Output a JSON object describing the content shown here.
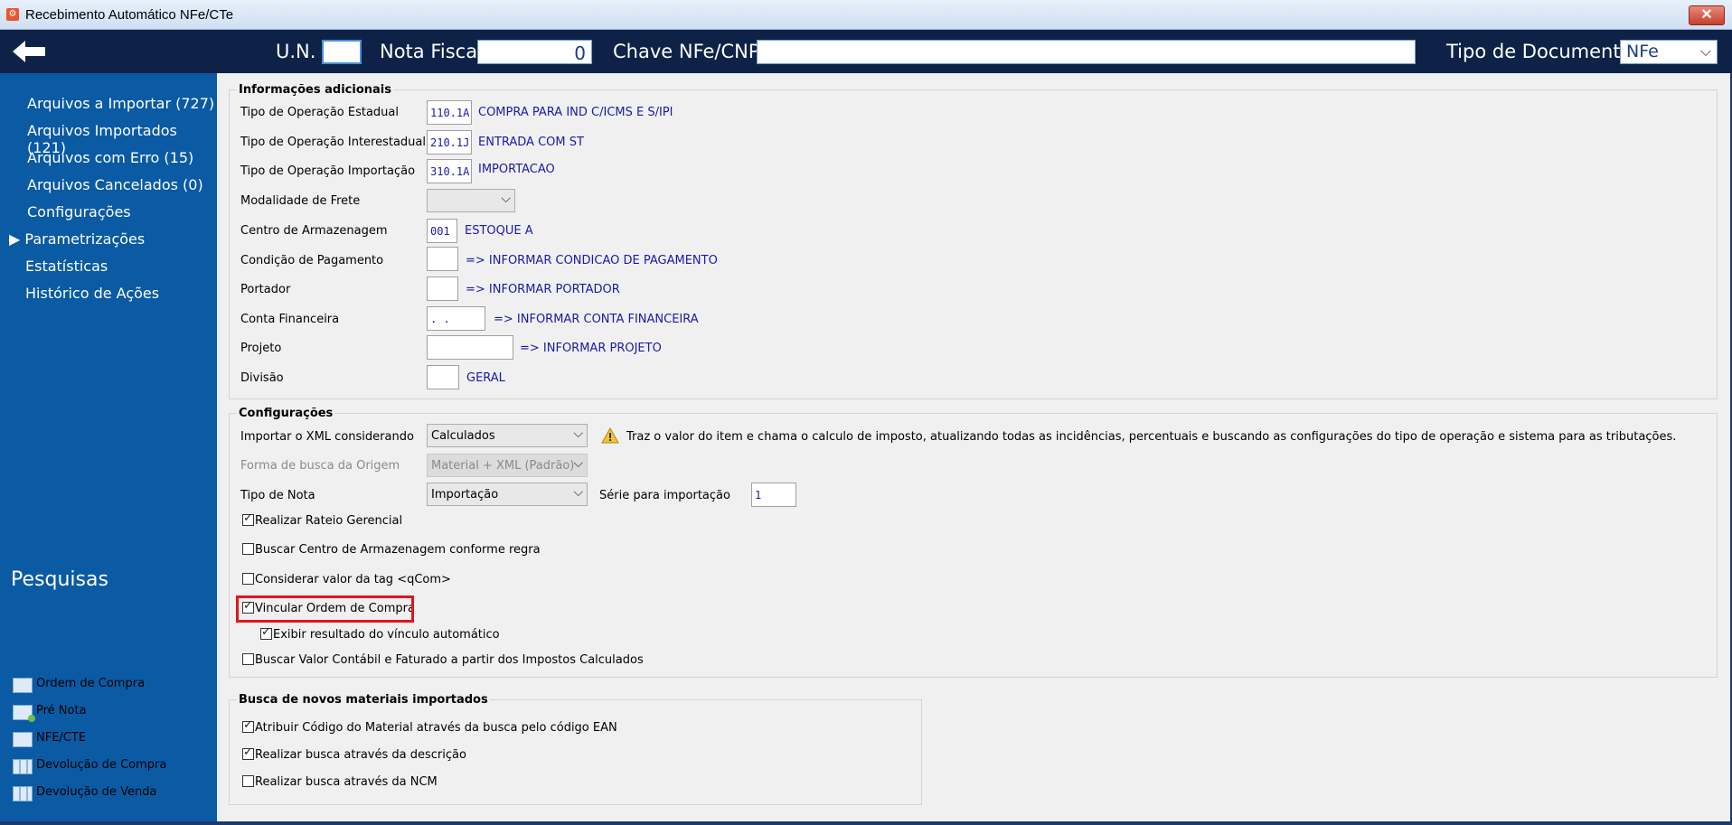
{
  "window": {
    "title": "Recebimento Automático NFe/CTe",
    "close_label": "✕"
  },
  "toolbar": {
    "un_label": "U.N.",
    "un_value": "",
    "nota_label": "Nota Fiscal",
    "nota_value": "0",
    "chave_label": "Chave NFe/CNPJ",
    "chave_value": "",
    "tipo_label": "Tipo de Documento",
    "tipo_value": "NFe",
    "chevron": "⌵"
  },
  "sidebar": {
    "items": [
      {
        "label": "Arquivos a Importar (727)"
      },
      {
        "label": "Arquivos Importados (121)"
      },
      {
        "label": "Arquivos com Erro (15)"
      },
      {
        "label": "Arquivos Cancelados (0)"
      },
      {
        "label": "Configurações"
      },
      {
        "label": "▶ Parametrizações"
      },
      {
        "label": "Estatísticas"
      },
      {
        "label": "Histórico de Ações"
      }
    ],
    "pesquisas_heading": "Pesquisas",
    "pesquisas": [
      {
        "label": "Ordem de Compra",
        "icon": "window-icon"
      },
      {
        "label": "Pré Nota",
        "icon": "window-add-icon"
      },
      {
        "label": "NFE/CTE",
        "icon": "windows-icon"
      },
      {
        "label": "Devolução de Compra",
        "icon": "grid-icon"
      },
      {
        "label": "Devolução de Venda",
        "icon": "grid-icon"
      }
    ]
  },
  "info": {
    "legend": "Informações adicionais",
    "rows": [
      {
        "label": "Tipo de Operação Estadual",
        "code": "110.1A",
        "desc": "COMPRA PARA IND C/ICMS E S/IPI"
      },
      {
        "label": "Tipo de Operação Interestadual",
        "code": "210.1J",
        "desc": "ENTRADA COM ST"
      },
      {
        "label": "Tipo de Operação Importação",
        "code": "310.1A",
        "desc": "IMPORTACAO"
      },
      {
        "label": "Modalidade de Frete",
        "code": "",
        "desc": ""
      },
      {
        "label": "Centro de Armazenagem",
        "code": "001",
        "desc": "ESTOQUE A"
      },
      {
        "label": "Condição de Pagamento",
        "code": "",
        "desc": "=> INFORMAR CONDICAO DE PAGAMENTO"
      },
      {
        "label": "Portador",
        "code": "",
        "desc": "=> INFORMAR PORTADOR"
      },
      {
        "label": "Conta Financeira",
        "code": ". .",
        "desc": "=> INFORMAR CONTA FINANCEIRA"
      },
      {
        "label": "Projeto",
        "code": "",
        "desc": "=> INFORMAR PROJETO"
      },
      {
        "label": "Divisão",
        "code": "",
        "desc": "GERAL"
      }
    ]
  },
  "config": {
    "legend": "Configurações",
    "importar_label": "Importar o XML considerando",
    "importar_value": "Calculados",
    "importar_hint": "Traz o valor do item e chama o calculo de imposto, atualizando todas as incidências, percentuais e buscando as configurações do tipo de operação e sistema para as tributações.",
    "forma_label": "Forma de busca da Origem",
    "forma_value": "Material + XML (Padrão)",
    "tipo_nota_label": "Tipo de Nota",
    "tipo_nota_value": "Importação",
    "serie_label": "Série para importação",
    "serie_value": "1",
    "checks": [
      {
        "label": "Realizar Rateio Gerencial",
        "checked": true
      },
      {
        "label": "Buscar Centro de Armazenagem conforme regra",
        "checked": false
      },
      {
        "label": "Considerar valor da tag <qCom>",
        "checked": false
      },
      {
        "label": "Vincular Ordem de Compra",
        "checked": true
      },
      {
        "label": "Exibir resultado do vínculo automático",
        "checked": true
      },
      {
        "label": "Buscar Valor Contábil e Faturado a partir dos Impostos Calculados",
        "checked": false
      }
    ]
  },
  "busca": {
    "legend": "Busca de novos materiais importados",
    "checks": [
      {
        "label": "Atribuir Código do Material através da busca pelo código EAN",
        "checked": true
      },
      {
        "label": "Realizar busca através da descrição",
        "checked": true
      },
      {
        "label": "Realizar busca através da NCM",
        "checked": false
      }
    ]
  }
}
